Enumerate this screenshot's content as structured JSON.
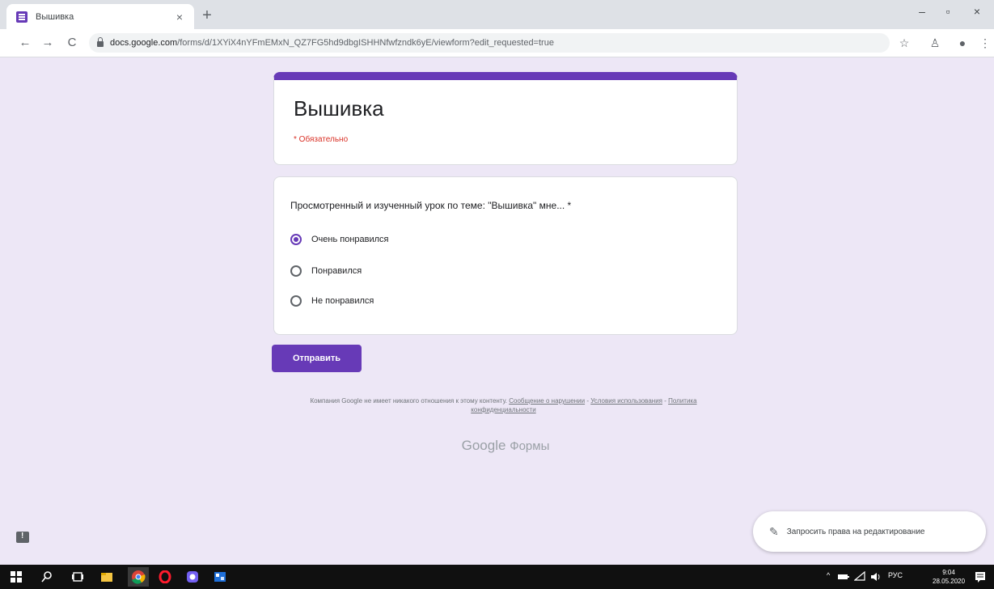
{
  "browser": {
    "tab_title": "Вышивка",
    "tab_close": "×",
    "new_tab": "+",
    "window": {
      "minimize": "–",
      "maximize": "▫",
      "close": "×"
    },
    "nav": {
      "back": "←",
      "forward": "→",
      "reload": "C"
    },
    "url_host": "docs.google.com",
    "url_path": "/forms/d/1XYiX4nYFmEMxN_QZ7FG5hd9dbgISHHNfwfzndk6yE/viewform?edit_requested=true",
    "toolbar_icons": {
      "star": "☆",
      "extensions": "♙",
      "profile": "●",
      "menu": "⋮"
    }
  },
  "form": {
    "title": "Вышивка",
    "required_note": "* Обязательно",
    "question": "Просмотренный и изученный урок по теме: \"Вышивка\" мне... *",
    "options": [
      "Очень понравился",
      "Понравился",
      "Не понравился"
    ],
    "selected_index": 0,
    "submit_label": "Отправить",
    "footer": {
      "text": "Компания Google не имеет никакого отношения к этому контенту.",
      "link_report": "Сообщение о нарушении",
      "sep1": " - ",
      "link_terms": "Условия использования",
      "sep2": " - ",
      "link_privacy": "Политика конфиденциальности"
    },
    "brand_word1": "Google",
    "brand_word2": "Формы"
  },
  "fab": {
    "label": "Запросить права на редактирование",
    "icon": "pencil-icon"
  },
  "taskbar": {
    "tray_lang": "РУС",
    "time": "9:04",
    "date": "28.05.2020",
    "tray_arrow": "^"
  },
  "colors": {
    "accent": "#673ab7",
    "page_bg": "#ede7f6",
    "required": "#d93025"
  }
}
